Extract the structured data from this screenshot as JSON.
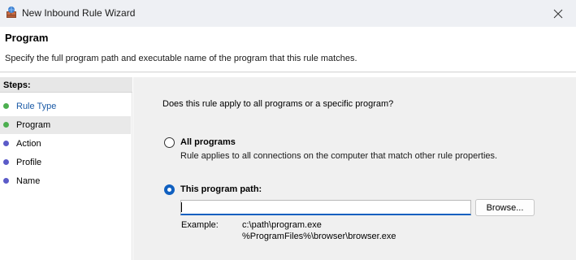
{
  "window": {
    "title": "New Inbound Rule Wizard"
  },
  "header": {
    "title": "Program",
    "description": "Specify the full program path and executable name of the program that this rule matches."
  },
  "steps": {
    "heading": "Steps:",
    "items": [
      {
        "label": "Rule Type",
        "state": "done"
      },
      {
        "label": "Program",
        "state": "current"
      },
      {
        "label": "Action",
        "state": "pending"
      },
      {
        "label": "Profile",
        "state": "pending"
      },
      {
        "label": "Name",
        "state": "pending"
      }
    ],
    "colors": {
      "done": "#4caf50",
      "pending": "#5b5bc8"
    }
  },
  "main": {
    "question": "Does this rule apply to all programs or a specific program?",
    "all_programs": {
      "label": "All programs",
      "description": "Rule applies to all connections on the computer that match other rule properties.",
      "selected": false
    },
    "this_program": {
      "label": "This program path:",
      "selected": true,
      "value": ""
    },
    "browse_label": "Browse...",
    "example_label": "Example:",
    "example_lines": [
      "c:\\path\\program.exe",
      "%ProgramFiles%\\browser\\browser.exe"
    ]
  },
  "icons": {
    "app": "firewall-icon",
    "close": "close-icon"
  }
}
